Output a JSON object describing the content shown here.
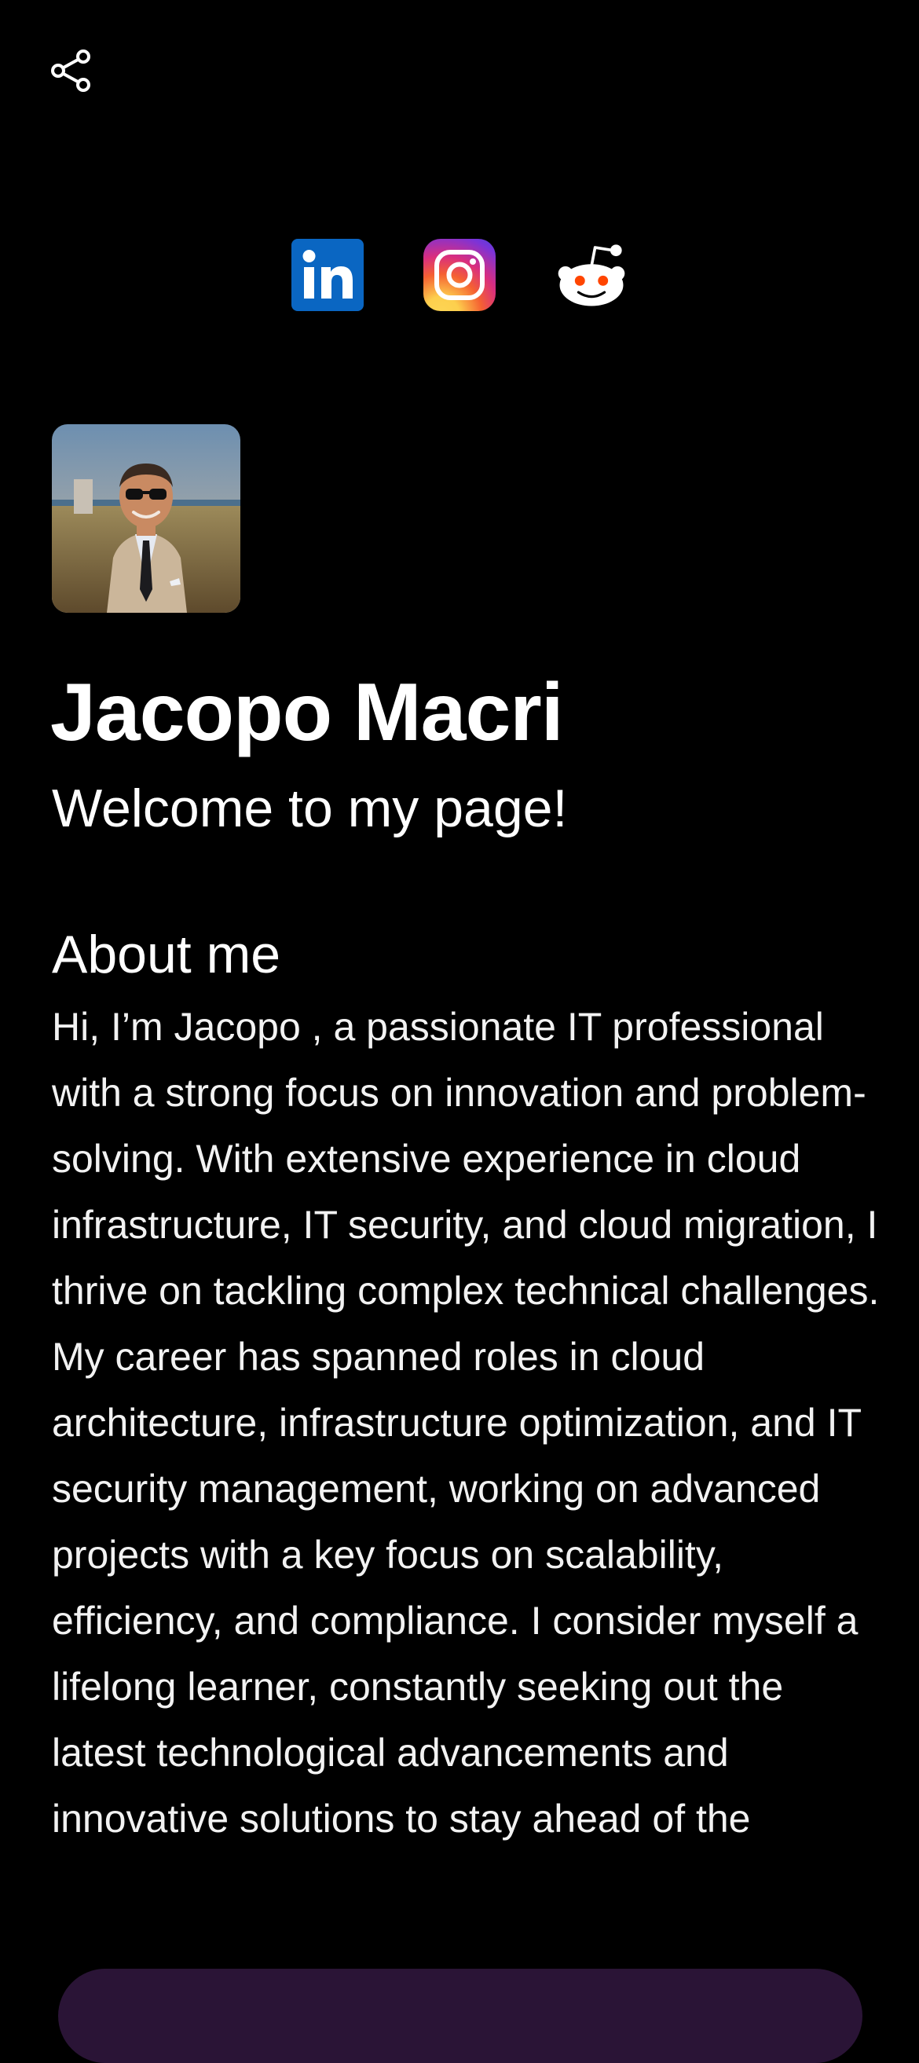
{
  "profile": {
    "name": "Jacopo Macri",
    "tagline": "Welcome to my page!"
  },
  "icons": {
    "share": "share-icon",
    "linkedin": "linkedin-icon",
    "instagram": "instagram-icon",
    "reddit": "reddit-icon",
    "avatar": "profile-photo"
  },
  "colors": {
    "background": "#000000",
    "text": "#ffffff",
    "linkedin": "#0a66c2",
    "reddit": "#ff4500",
    "bottom_bar": "#2a1436"
  },
  "about": {
    "title": "About me",
    "text": "Hi, I’m Jacopo , a passionate IT professional with a strong focus on innovation and problem-solving. With extensive experience in cloud infrastructure, IT security, and cloud migration, I thrive on tackling complex technical challenges. My career has spanned roles in cloud architecture, infrastructure optimization, and IT security management, working on advanced projects with a key focus on scalability, efficiency, and compliance. I consider myself a lifelong learner, constantly seeking out the latest technological advancements and innovative solutions to stay ahead of the"
  }
}
